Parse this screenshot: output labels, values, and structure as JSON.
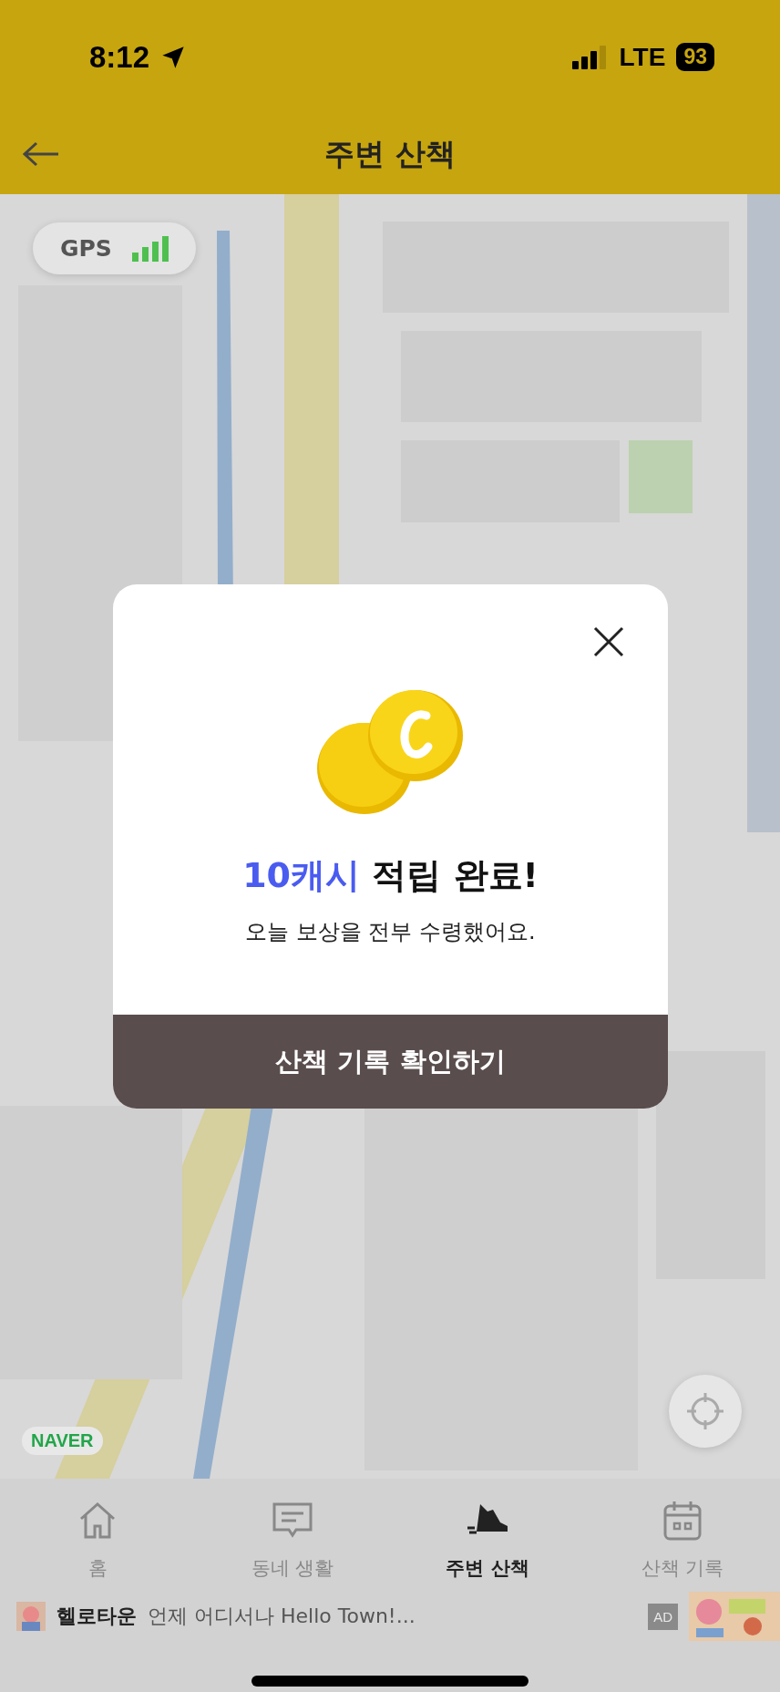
{
  "status_bar": {
    "time": "8:12",
    "network": "LTE",
    "battery": "93"
  },
  "header": {
    "title": "주변 산책"
  },
  "map": {
    "kind": "picture",
    "gps_label": "GPS",
    "provider": "NAVER"
  },
  "dialog": {
    "title_highlight": "10캐시",
    "title_rest": " 적립 완료!",
    "message": "오늘 보상을 전부 수령했어요.",
    "button": "산책 기록 확인하기"
  },
  "tabs": [
    {
      "label": "홈",
      "kind": "home",
      "selected": false
    },
    {
      "label": "동네 생활",
      "kind": "chat",
      "selected": false
    },
    {
      "label": "주변 산책",
      "kind": "walk",
      "selected": true
    },
    {
      "label": "산책 기록",
      "kind": "calendar",
      "selected": false
    }
  ],
  "ad": {
    "brand": "헬로타운",
    "text": "언제 어디서나 Hello Town!...",
    "badge": "AD"
  }
}
